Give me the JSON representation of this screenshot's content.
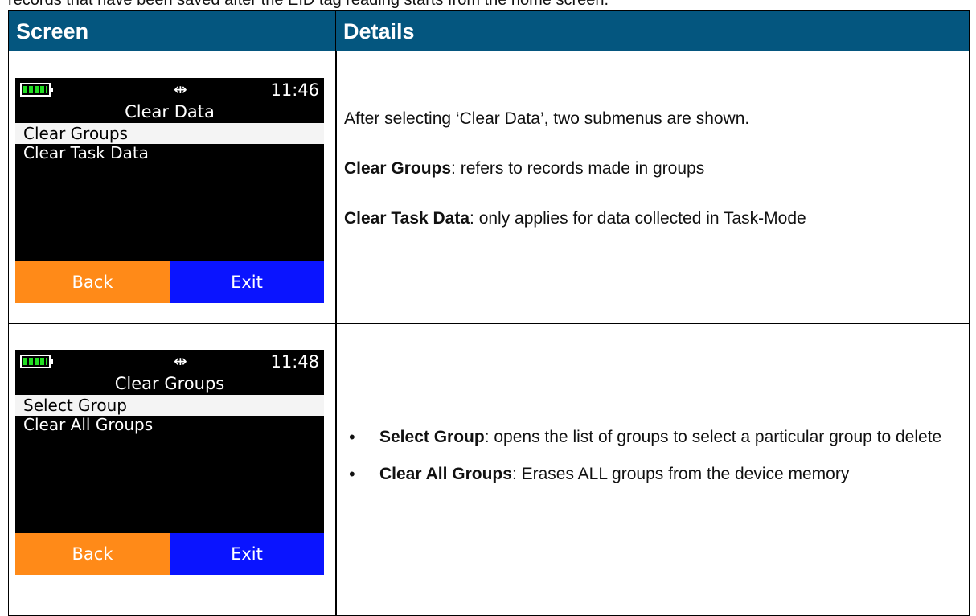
{
  "intro_text": "records that have been saved after the EID tag reading starts from the home screen.",
  "table": {
    "header_screen": "Screen",
    "header_details": "Details"
  },
  "rows": [
    {
      "device": {
        "time": "11:46",
        "usb_icon": "⇹",
        "title": "Clear Data",
        "menu": [
          "Clear Groups",
          "Clear Task Data"
        ],
        "selected_index": 0,
        "back_label": "Back",
        "exit_label": "Exit"
      },
      "details": {
        "intro": "After selecting ‘Clear Data’, two submenus are shown.",
        "item1_term": "Clear Groups",
        "item1_text": ": refers to records made in groups",
        "item2_term": "Clear Task Data",
        "item2_text": ": only applies for data collected in Task-Mode"
      }
    },
    {
      "device": {
        "time": "11:48",
        "usb_icon": "⇹",
        "title": "Clear Groups",
        "menu": [
          "Select Group",
          "Clear All Groups"
        ],
        "selected_index": 0,
        "back_label": "Back",
        "exit_label": "Exit"
      },
      "details": {
        "bullet1_term": "Select Group",
        "bullet1_text": ": opens the list of groups to select a particular group to delete",
        "bullet2_term": "Clear All Groups",
        "bullet2_text": ": Erases ALL groups from the device memory"
      }
    }
  ],
  "colors": {
    "header_bg": "#04567f",
    "softkey_back": "#ff8a18",
    "softkey_exit": "#0a14ff",
    "battery": "#22dd22"
  }
}
